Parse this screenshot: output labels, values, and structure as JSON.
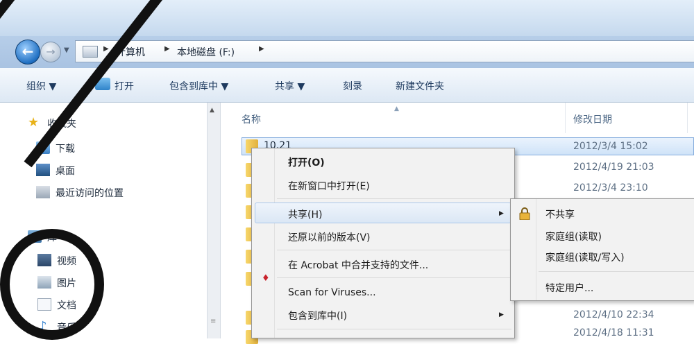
{
  "address": {
    "crumbs": [
      "计算机",
      "本地磁盘 (F:)"
    ]
  },
  "toolbar": {
    "organize": "组织 ▼",
    "open": "打开",
    "include_library": "包含到库中 ▼",
    "share": "共享 ▼",
    "burn": "刻录",
    "new_folder": "新建文件夹"
  },
  "nav": {
    "favorites": "收藏夹",
    "downloads": "下载",
    "desktop": "桌面",
    "recent": "最近访问的位置",
    "libraries": "库",
    "videos": "视频",
    "pictures": "图片",
    "documents": "文档",
    "music": "音乐"
  },
  "columns": {
    "name": "名称",
    "modified": "修改日期"
  },
  "files": [
    {
      "name": "10.21",
      "date": "2012/3/4 15:02"
    },
    {
      "name": "",
      "date": "2012/4/19 21:03"
    },
    {
      "name": "",
      "date": "2012/3/4 23:10"
    },
    {
      "name": "",
      "date": "2012/4/10 22:34"
    },
    {
      "name": "",
      "date": "2012/4/18 11:31"
    }
  ],
  "context_menu": {
    "open": "打开(O)",
    "open_new_window": "在新窗口中打开(E)",
    "share": "共享(H)",
    "restore": "还原以前的版本(V)",
    "acrobat": "在 Acrobat 中合并支持的文件...",
    "scan": "Scan for Viruses...",
    "include_library": "包含到库中(I)"
  },
  "share_submenu": {
    "nobody": "不共享",
    "homegroup_read": "家庭组(读取)",
    "homegroup_readwrite": "家庭组(读取/写入)",
    "specific_people": "特定用户..."
  },
  "colors": {
    "accent": "#1f6fc2",
    "selection": "#cfe3f8",
    "folder": "#e2b13c"
  }
}
